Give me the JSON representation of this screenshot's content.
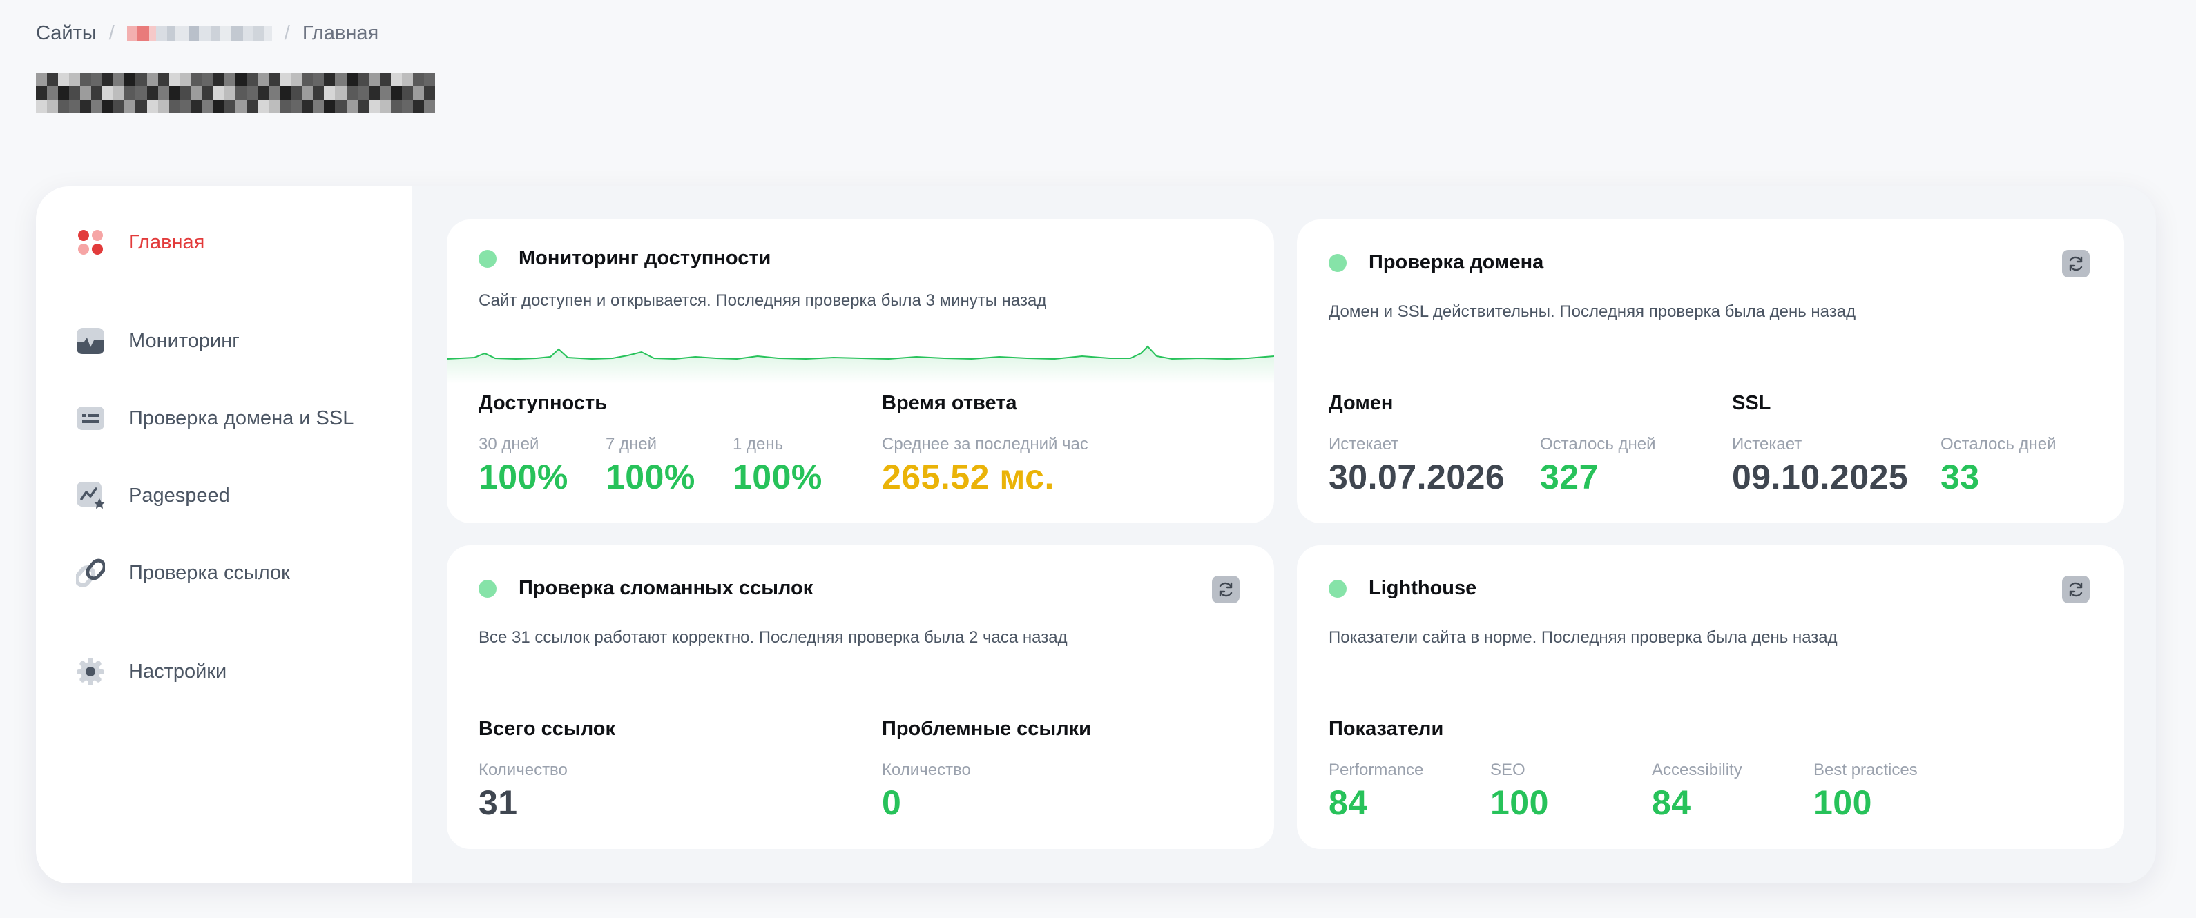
{
  "breadcrumb": {
    "root": "Сайты",
    "separator": "/",
    "current": "Главная"
  },
  "sidebar": {
    "items": [
      {
        "label": "Главная",
        "icon": "dashboard-icon",
        "active": true
      },
      {
        "label": "Мониторинг",
        "icon": "monitor-icon",
        "active": false
      },
      {
        "label": "Проверка домена и SSL",
        "icon": "domain-icon",
        "active": false
      },
      {
        "label": "Pagespeed",
        "icon": "pagespeed-icon",
        "active": false
      },
      {
        "label": "Проверка ссылок",
        "icon": "link-icon",
        "active": false
      },
      {
        "label": "Настройки",
        "icon": "gear-icon",
        "active": false
      }
    ]
  },
  "cards": {
    "uptime": {
      "title": "Мониторинг доступности",
      "description": "Сайт доступен и открывается. Последняя проверка была 3 минуты назад",
      "availability_heading": "Доступность",
      "periods": [
        {
          "label": "30 дней",
          "value": "100%"
        },
        {
          "label": "7 дней",
          "value": "100%"
        },
        {
          "label": "1 день",
          "value": "100%"
        }
      ],
      "response_heading": "Время ответа",
      "response_label": "Среднее за последний час",
      "response_value": "265.52 мс."
    },
    "domain": {
      "title": "Проверка домена",
      "description": "Домен и SSL действительны. Последняя проверка была день назад",
      "domain_heading": "Домен",
      "domain_expires_label": "Истекает",
      "domain_expires_value": "30.07.2026",
      "domain_days_label": "Осталось дней",
      "domain_days_value": "327",
      "ssl_heading": "SSL",
      "ssl_expires_label": "Истекает",
      "ssl_expires_value": "09.10.2025",
      "ssl_days_label": "Осталось дней",
      "ssl_days_value": "33"
    },
    "links": {
      "title": "Проверка сломанных ссылок",
      "description": "Все 31 ссылок работают корректно. Последняя проверка была 2 часа назад",
      "total_heading": "Всего ссылок",
      "total_label": "Количество",
      "total_value": "31",
      "broken_heading": "Проблемные ссылки",
      "broken_label": "Количество",
      "broken_value": "0"
    },
    "lighthouse": {
      "title": "Lighthouse",
      "description": "Показатели сайта в норме. Последняя проверка была день назад",
      "metrics_heading": "Показатели",
      "metrics": [
        {
          "label": "Performance",
          "value": "84"
        },
        {
          "label": "SEO",
          "value": "100"
        },
        {
          "label": "Accessibility",
          "value": "84"
        },
        {
          "label": "Best practices",
          "value": "100"
        }
      ]
    }
  },
  "colors": {
    "accent_red": "#e23b3b",
    "status_green": "#27c25a",
    "status_dot": "#86e3a8",
    "warning_orange": "#eab308"
  }
}
